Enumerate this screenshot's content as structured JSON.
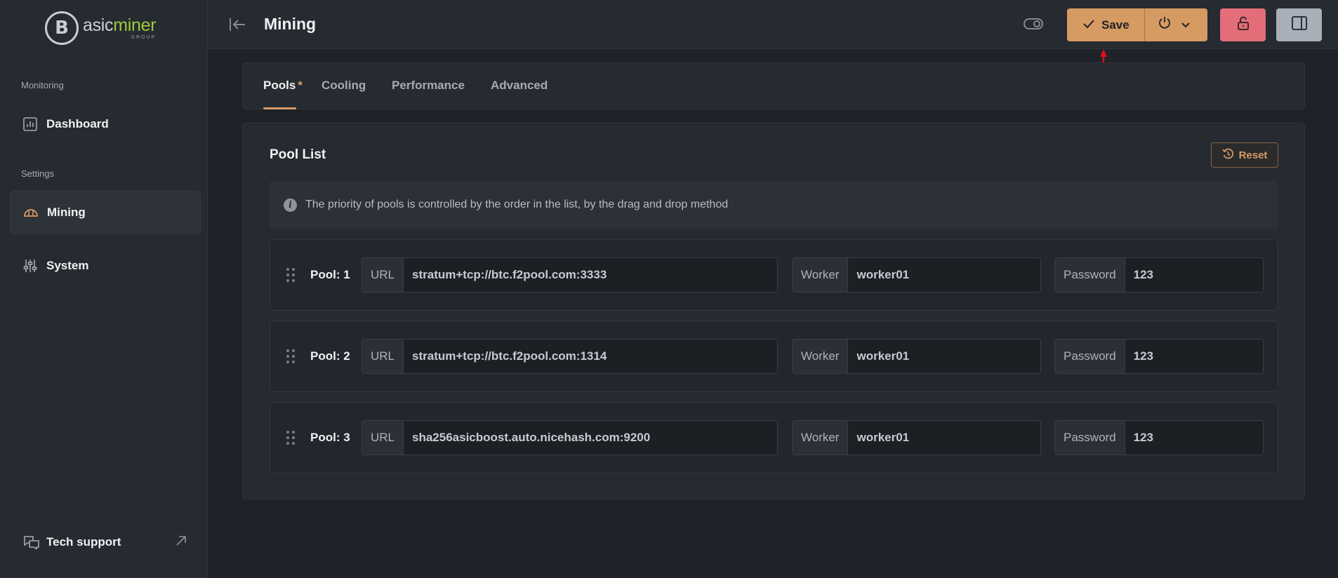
{
  "app": {
    "logo": {
      "name_prefix": "asic",
      "name_accent": "miner",
      "group": "GROUP"
    }
  },
  "sidebar": {
    "sections": [
      {
        "label": "Monitoring"
      },
      {
        "label": "Settings"
      }
    ],
    "items": [
      {
        "label": "Dashboard",
        "icon": "chart-icon"
      },
      {
        "label": "Mining",
        "icon": "mining-helmet-icon",
        "active": true
      },
      {
        "label": "System",
        "icon": "sliders-icon"
      }
    ],
    "tech_support": {
      "label": "Tech support"
    }
  },
  "header": {
    "title": "Mining",
    "save_label": "Save"
  },
  "tabs": [
    {
      "label": "Pools",
      "modified": "*",
      "active": true
    },
    {
      "label": "Cooling"
    },
    {
      "label": "Performance"
    },
    {
      "label": "Advanced"
    }
  ],
  "pool_list": {
    "title": "Pool List",
    "reset_label": "Reset",
    "info": "The priority of pools is controlled by the order in the list, by the drag and drop method",
    "field_labels": {
      "url": "URL",
      "worker": "Worker",
      "password": "Password"
    },
    "pools": [
      {
        "label": "Pool: 1",
        "url": "stratum+tcp://btc.f2pool.com:3333",
        "worker": "worker01",
        "password": "123"
      },
      {
        "label": "Pool: 2",
        "url": "stratum+tcp://btc.f2pool.com:1314",
        "worker": "worker01",
        "password": "123"
      },
      {
        "label": "Pool: 3",
        "url": "sha256asicboost.auto.nicehash.com:9200",
        "worker": "worker01",
        "password": "123"
      }
    ]
  },
  "colors": {
    "accent": "#d69a63",
    "danger": "#e36d78",
    "brand_green": "#9cc93a",
    "annotation_arrow": "#e0101a"
  }
}
